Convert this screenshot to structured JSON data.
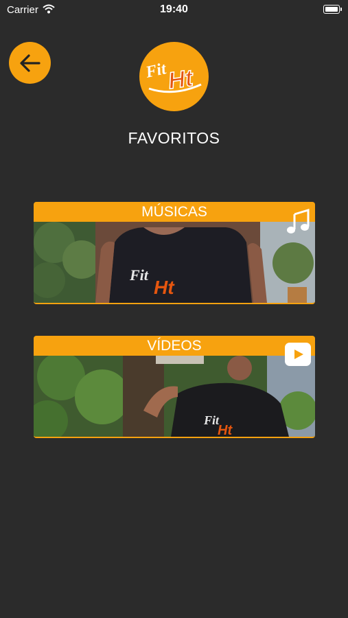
{
  "status_bar": {
    "carrier": "Carrier",
    "time": "19:40"
  },
  "header": {
    "title": "FAVORITOS",
    "logo_text_top": "Fit",
    "logo_text_bottom": "Ht"
  },
  "cards": [
    {
      "label": "MÚSICAS",
      "icon": "music-note-icon",
      "shirt_text_top": "Fit",
      "shirt_text_bottom": "Ht"
    },
    {
      "label": "VÍDEOS",
      "icon": "play-video-icon",
      "shirt_text_top": "Fit",
      "shirt_text_bottom": "Ht"
    }
  ],
  "colors": {
    "accent": "#f7a20f",
    "background": "#2b2b2b"
  }
}
